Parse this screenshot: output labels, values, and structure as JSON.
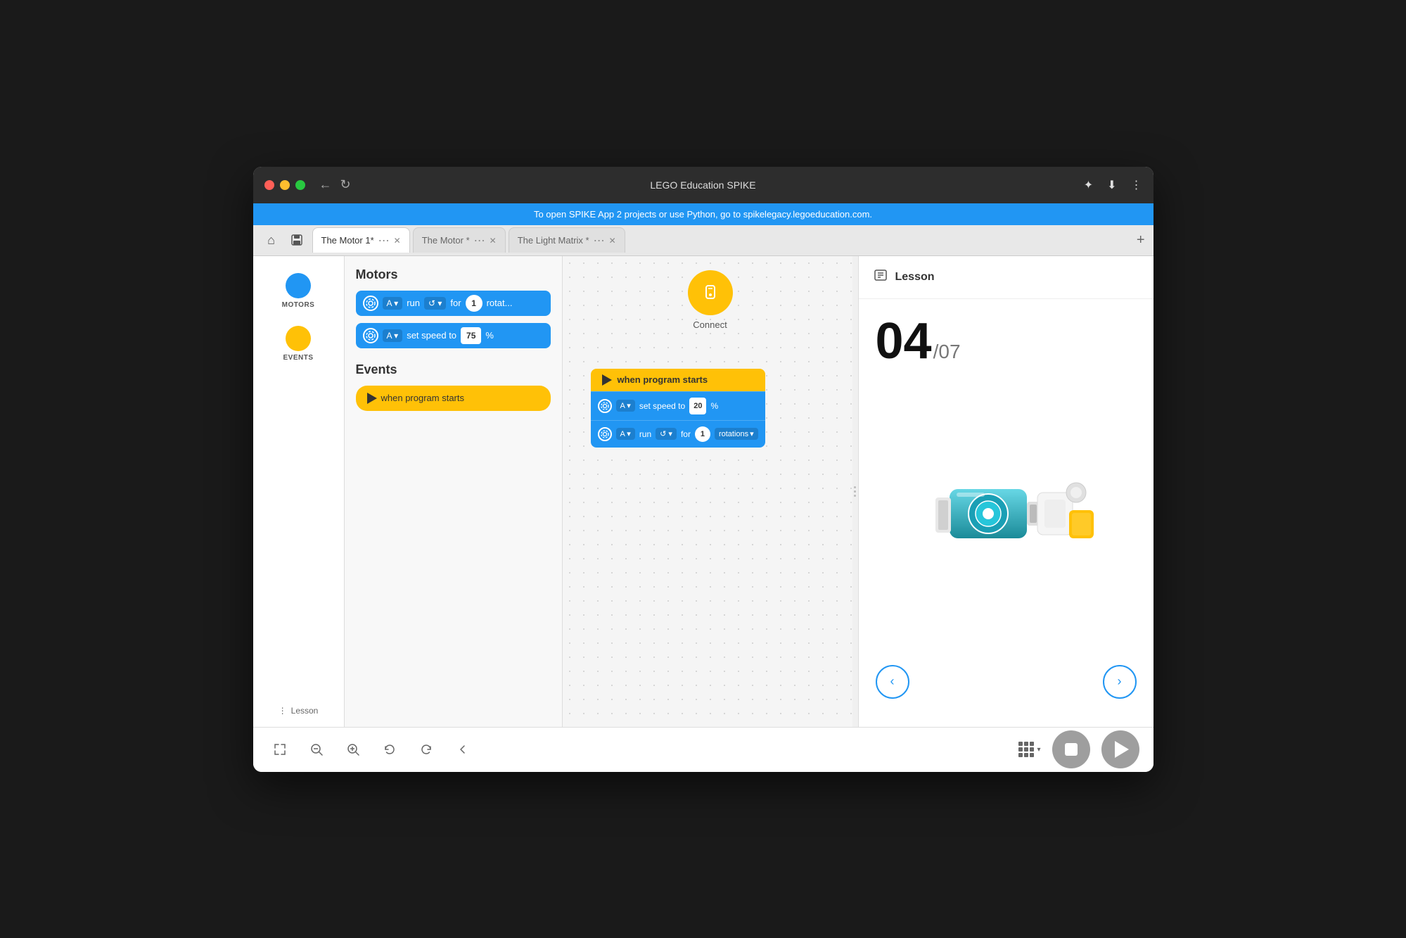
{
  "window": {
    "title": "LEGO Education SPIKE",
    "traffic_lights": [
      "red",
      "yellow",
      "green"
    ]
  },
  "banner": {
    "text": "To open SPIKE App 2 projects or use Python, go to spikelegacy.legoeducation.com."
  },
  "tabs": [
    {
      "label": "The Motor 1*",
      "active": true
    },
    {
      "label": "The Motor *",
      "active": false
    },
    {
      "label": "The Light Matrix *",
      "active": false
    }
  ],
  "sidebar": {
    "items": [
      {
        "label": "MOTORS",
        "color": "blue",
        "active": true
      },
      {
        "label": "EVENTS",
        "color": "yellow",
        "active": false
      }
    ],
    "bottom_label": "Lesson"
  },
  "blocks_panel": {
    "motors_title": "Motors",
    "events_title": "Events",
    "motor_block1": {
      "port": "A",
      "action": "run",
      "for_value": "1",
      "unit": "rotat..."
    },
    "motor_block2": {
      "port": "A",
      "action": "set speed to",
      "value": "75",
      "unit": "%"
    },
    "event_block1": {
      "label": "when program starts"
    }
  },
  "canvas": {
    "connect_label": "Connect",
    "code_group": {
      "when_label": "when program starts",
      "row1_port": "A",
      "row1_action": "set speed to",
      "row1_value": "20",
      "row1_unit": "%",
      "row2_port": "A",
      "row2_action": "run",
      "row2_for_value": "1",
      "row2_unit": "rotations"
    }
  },
  "lesson": {
    "title": "Lesson",
    "current": "04",
    "total": "/07",
    "prev_btn": "‹",
    "next_btn": "›"
  },
  "toolbar": {
    "zoom_out": "−",
    "zoom_in": "+",
    "undo": "↺",
    "redo": "↻",
    "back": "‹",
    "stop_label": "stop",
    "play_label": "play"
  }
}
